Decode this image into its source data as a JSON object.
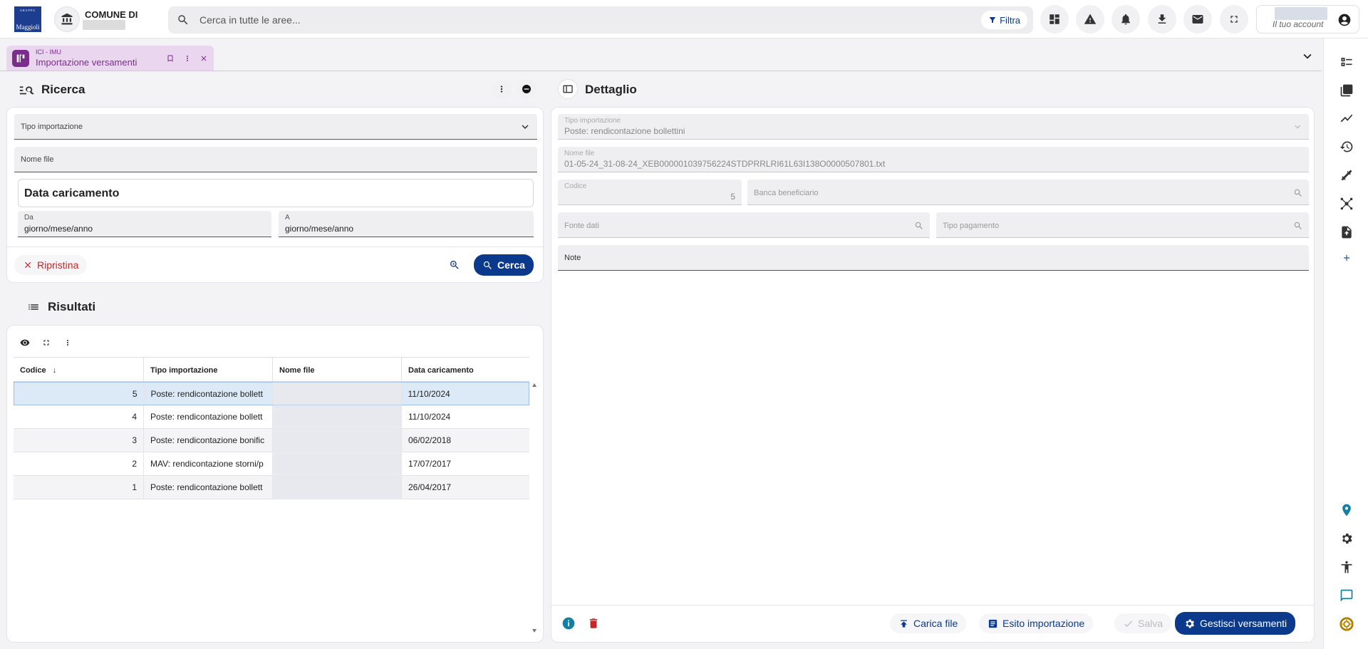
{
  "header": {
    "comune_label": "COMUNE DI",
    "search_placeholder": "Cerca in tutte le aree...",
    "filter_label": "Filtra",
    "account_label": "Il tuo account",
    "logo_text": "Maggioli"
  },
  "tab": {
    "module": "ICI - IMU",
    "title": "Importazione versamenti"
  },
  "ricerca": {
    "title": "Ricerca",
    "tipo_importazione_label": "Tipo importazione",
    "nome_file_label": "Nome file",
    "data_caricamento_title": "Data caricamento",
    "da_label": "Da",
    "da_value": "giorno/mese/anno",
    "a_label": "A",
    "a_value": "giorno/mese/anno",
    "reset_label": "Ripristina",
    "search_label": "Cerca"
  },
  "risultati": {
    "title": "Risultati",
    "columns": [
      "Codice",
      "Tipo importazione",
      "Nome file",
      "Data caricamento"
    ],
    "rows": [
      {
        "codice": "5",
        "tipo": "Poste: rendicontazione bollett",
        "data": "11/10/2024"
      },
      {
        "codice": "4",
        "tipo": "Poste: rendicontazione bollett",
        "data": "11/10/2024"
      },
      {
        "codice": "3",
        "tipo": "Poste: rendicontazione bonific",
        "data": "06/02/2018"
      },
      {
        "codice": "2",
        "tipo": "MAV: rendicontazione storni/p",
        "data": "17/07/2017"
      },
      {
        "codice": "1",
        "tipo": "Poste: rendicontazione bollett",
        "data": "26/04/2017"
      }
    ]
  },
  "dettaglio": {
    "title": "Dettaglio",
    "tipo_importazione_label": "Tipo importazione",
    "tipo_importazione_value": "Poste: rendicontazione bollettini",
    "nome_file_label": "Nome file",
    "nome_file_value": "01-05-24_31-08-24_XEB000001039756224STDPRRLRI61L63I138O0000507801.txt",
    "codice_label": "Codice",
    "codice_value": "5",
    "banca_label": "Banca beneficiario",
    "fonte_label": "Fonte dati",
    "tipo_pagamento_label": "Tipo pagamento",
    "note_label": "Note",
    "carica_file_label": "Carica file",
    "esito_label": "Esito importazione",
    "salva_label": "Salva",
    "gestisci_label": "Gestisci versamenti"
  }
}
